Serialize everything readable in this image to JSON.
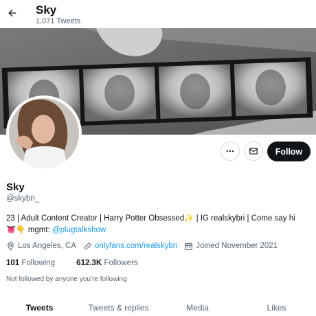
{
  "header": {
    "title": "Sky",
    "tweet_count": "1,071 Tweets",
    "back_icon": "arrow-left-icon"
  },
  "profile": {
    "display_name": "Sky",
    "handle": "@skybri_",
    "bio_line1_text": "23 | Adult Content Creator | Harry Potter Obsessed",
    "bio_line1_emoji": "✨",
    "bio_line1_rest": " | IG realskybri | Come say hi",
    "bio_line2_emoji": "👅👇",
    "bio_line2_prefix": " mgmt: ",
    "bio_mention": "@plugtalkshow",
    "location": "Los Angeles, CA",
    "website": "onlyfans.com/realskybri",
    "joined": "Joined November 2021",
    "following_count": "101",
    "following_label": "Following",
    "followers_count": "612.3K",
    "followers_label": "Followers",
    "followed_by_note": "Not followed by anyone you’re following"
  },
  "actions": {
    "more_icon": "more-icon",
    "message_icon": "mail-icon",
    "follow_label": "Follow"
  },
  "tabs": [
    {
      "label": "Tweets",
      "active": true
    },
    {
      "label": "Tweets & replies",
      "active": false
    },
    {
      "label": "Media",
      "active": false
    },
    {
      "label": "Likes",
      "active": false
    }
  ],
  "colors": {
    "accent": "#1d9bf0",
    "text": "#0f1419",
    "secondary": "#536471",
    "button_dark": "#0f1419"
  }
}
